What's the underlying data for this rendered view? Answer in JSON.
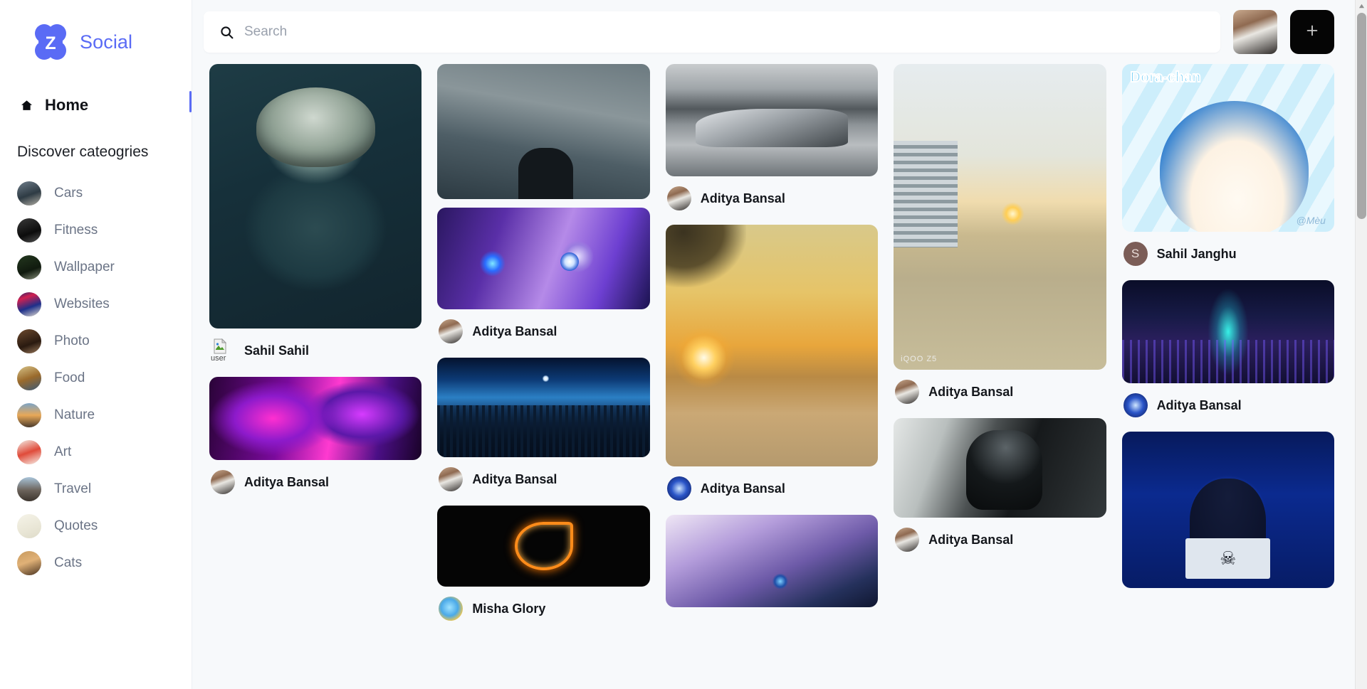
{
  "brand": {
    "name": "Social",
    "mark_letter": "Z",
    "accent": "#5a6bf5"
  },
  "sidebar": {
    "home_label": "Home",
    "discover_title": "Discover cateogries",
    "categories": [
      {
        "label": "Cars",
        "thumb": "t-cars"
      },
      {
        "label": "Fitness",
        "thumb": "t-fitness"
      },
      {
        "label": "Wallpaper",
        "thumb": "t-wallpaper"
      },
      {
        "label": "Websites",
        "thumb": "t-websites"
      },
      {
        "label": "Photo",
        "thumb": "t-photo"
      },
      {
        "label": "Food",
        "thumb": "t-food"
      },
      {
        "label": "Nature",
        "thumb": "t-nature"
      },
      {
        "label": "Art",
        "thumb": "t-art"
      },
      {
        "label": "Travel",
        "thumb": "t-travel"
      },
      {
        "label": "Quotes",
        "thumb": "t-quotes"
      },
      {
        "label": "Cats",
        "thumb": "t-cats"
      }
    ]
  },
  "topbar": {
    "search_placeholder": "Search",
    "search_value": "",
    "search_icon": "search-icon",
    "add_icon": "plus-icon",
    "avatar_name": "profile-avatar"
  },
  "feed": {
    "columns": [
      {
        "cards": [
          {
            "media": "ph-soldier",
            "alt": "soldier-portrait",
            "author": "Sahil Sahil",
            "avatar_type": "broken",
            "avatar_alt": "user"
          },
          {
            "media": "ph-demon",
            "alt": "anime-demon-slayer",
            "author": "Aditya Bansal",
            "avatar_type": "photo",
            "avatar_class": "av-aditya"
          },
          {
            "media": "ph-mountain-guy",
            "alt": "mountain-portrait",
            "author": "",
            "avatar_type": "none"
          }
        ]
      },
      {
        "cards": [
          {
            "media": "ph-anime1",
            "alt": "anime-blue-eye",
            "author": "Aditya Bansal",
            "avatar_type": "photo",
            "avatar_class": "av-aditya"
          },
          {
            "media": "ph-firewatch",
            "alt": "firewatch-lookout",
            "author": "Aditya Bansal",
            "avatar_type": "photo",
            "avatar_class": "av-aditya"
          },
          {
            "media": "ph-naruto",
            "alt": "konoha-leaf-symbol",
            "author": "Misha Glory",
            "avatar_type": "photo",
            "avatar_class": "av-misha"
          }
        ]
      },
      {
        "cards": [
          {
            "media": "ph-car",
            "alt": "grayscale-sports-car",
            "author": "Aditya Bansal",
            "avatar_type": "photo",
            "avatar_class": "av-aditya"
          },
          {
            "media": "ph-sunset",
            "alt": "golden-sunset-rocks",
            "author": "Aditya Bansal",
            "avatar_type": "photo",
            "avatar_class": "av-hacker"
          },
          {
            "media": "ph-anime2",
            "alt": "anime-white-hair",
            "author": "",
            "avatar_type": "none"
          }
        ]
      },
      {
        "cards": [
          {
            "media": "ph-campus",
            "alt": "campus-sunset-road",
            "watermark": "iQOO Z5",
            "author": "Aditya Bansal",
            "avatar_type": "photo",
            "avatar_class": "av-aditya"
          },
          {
            "media": "ph-bike",
            "alt": "dark-motorcycle",
            "author": "Aditya Bansal",
            "avatar_type": "photo",
            "avatar_class": "av-aditya"
          }
        ]
      },
      {
        "cards": [
          {
            "media": "ph-dora",
            "alt": "doraemon-illustration",
            "overlay_title": "Dora-chan",
            "overlay_sign": "@Mèu",
            "author": "Sahil Janghu",
            "avatar_type": "letter",
            "avatar_letter": "S"
          },
          {
            "media": "ph-cyber",
            "alt": "cyberpunk-city-night",
            "author": "Aditya Bansal",
            "avatar_type": "photo",
            "avatar_class": "av-hacker"
          },
          {
            "media": "ph-hacker",
            "alt": "hacker-hoodie-laptop",
            "author": "",
            "avatar_type": "none"
          }
        ]
      }
    ]
  },
  "scrollbar": {
    "up_icon": "triangle-up-icon",
    "down_icon": "triangle-down-icon"
  }
}
